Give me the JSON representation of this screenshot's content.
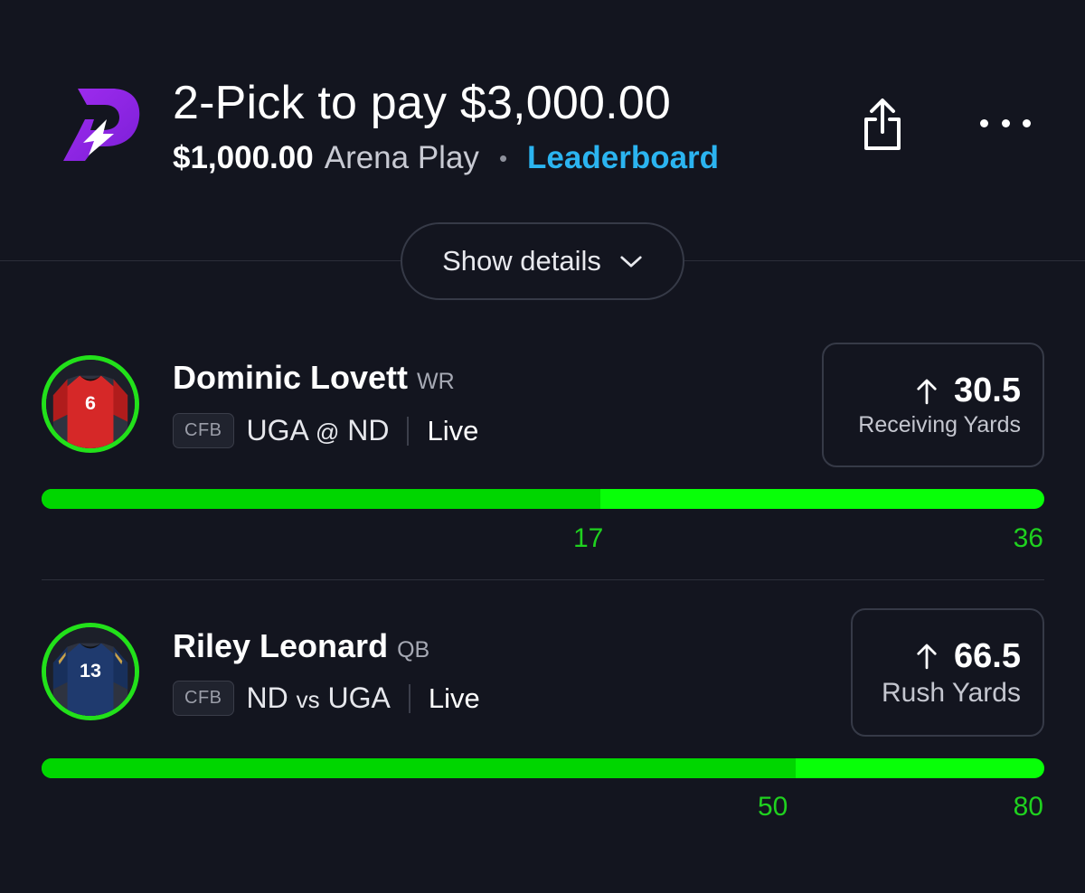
{
  "header": {
    "title": "2-Pick to pay $3,000.00",
    "entry_amount": "$1,000.00",
    "play_type": "Arena Play",
    "separator": "•",
    "leaderboard_link": "Leaderboard",
    "brand_color": "#8a2be2",
    "share_icon": "share-icon",
    "more_icon": "more-horizontal-icon"
  },
  "details_toggle": {
    "label": "Show details",
    "icon": "chevron-down-icon"
  },
  "picks": [
    {
      "player_name": "Dominic Lovett",
      "position": "WR",
      "league": "CFB",
      "team": "UGA",
      "connector": "@",
      "opponent": "ND",
      "status": "Live",
      "jersey_number": "6",
      "jersey_color": "#d62828",
      "direction_icon": "arrow-up-icon",
      "line": "30.5",
      "stat_type": "Receiving Yards",
      "progress_current": "17",
      "progress_max": "36",
      "progress_fraction": 0.557
    },
    {
      "player_name": "Riley Leonard",
      "position": "QB",
      "league": "CFB",
      "team": "ND",
      "connector": "vs",
      "opponent": "UGA",
      "status": "Live",
      "jersey_number": "13",
      "jersey_color": "#1f3a6e",
      "direction_icon": "arrow-up-icon",
      "line": "66.5",
      "stat_type": "Rush Yards",
      "progress_current": "50",
      "progress_max": "80",
      "progress_fraction": 0.752
    }
  ]
}
